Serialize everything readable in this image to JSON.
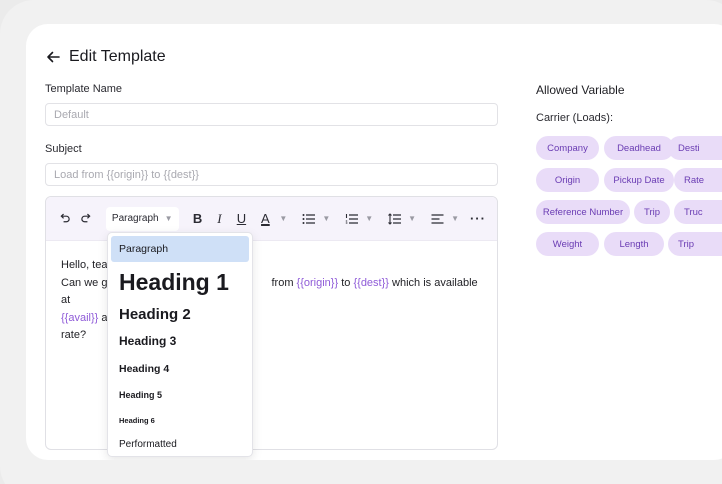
{
  "header": {
    "back_icon": "arrow-left-icon",
    "title": "Edit Template"
  },
  "template_name": {
    "label": "Template Name",
    "placeholder": "Default"
  },
  "subject": {
    "label": "Subject",
    "placeholder": "Load from {{origin}} to {{dest}}"
  },
  "toolbar": {
    "block_type": "Paragraph",
    "icons": [
      "undo-icon",
      "redo-icon",
      "bold-icon",
      "italic-icon",
      "underline-icon",
      "text-color-icon",
      "bullet-list-icon",
      "numbered-list-icon",
      "line-height-icon",
      "align-icon",
      "more-icon"
    ]
  },
  "editor": {
    "line1": "Hello, tea",
    "line2_start": "Can we g",
    "line2_mid": "from",
    "var_origin": "{{origin}}",
    "to_text": "to",
    "var_dest": "{{dest}}",
    "line2_end": "which is available at",
    "var_avail": "{{avail}}",
    "line3_rest": "a",
    "line4": "rate?"
  },
  "dropdown": {
    "items": [
      {
        "label": "Paragraph",
        "active": true
      },
      {
        "label": "Heading 1"
      },
      {
        "label": "Heading 2"
      },
      {
        "label": "Heading 3"
      },
      {
        "label": "Heading 4"
      },
      {
        "label": "Heading 5"
      },
      {
        "label": "Heading 6"
      },
      {
        "label": "Performatted"
      }
    ]
  },
  "sidebar": {
    "title": "Allowed Variable",
    "group_label": "Carrier (Loads):",
    "chips": [
      [
        "Company",
        "Deadhead",
        "Desti"
      ],
      [
        "Origin",
        "Pickup Date",
        "Rate"
      ],
      [
        "Reference Number",
        "Trip",
        "Truc"
      ],
      [
        "Weight",
        "Length",
        "Trip"
      ]
    ]
  },
  "colors": {
    "accent": "#8f5bd8",
    "chip_bg": "#e9dcf8",
    "chip_text": "#6a3cb3",
    "dropdown_active": "#cfe0f7"
  }
}
